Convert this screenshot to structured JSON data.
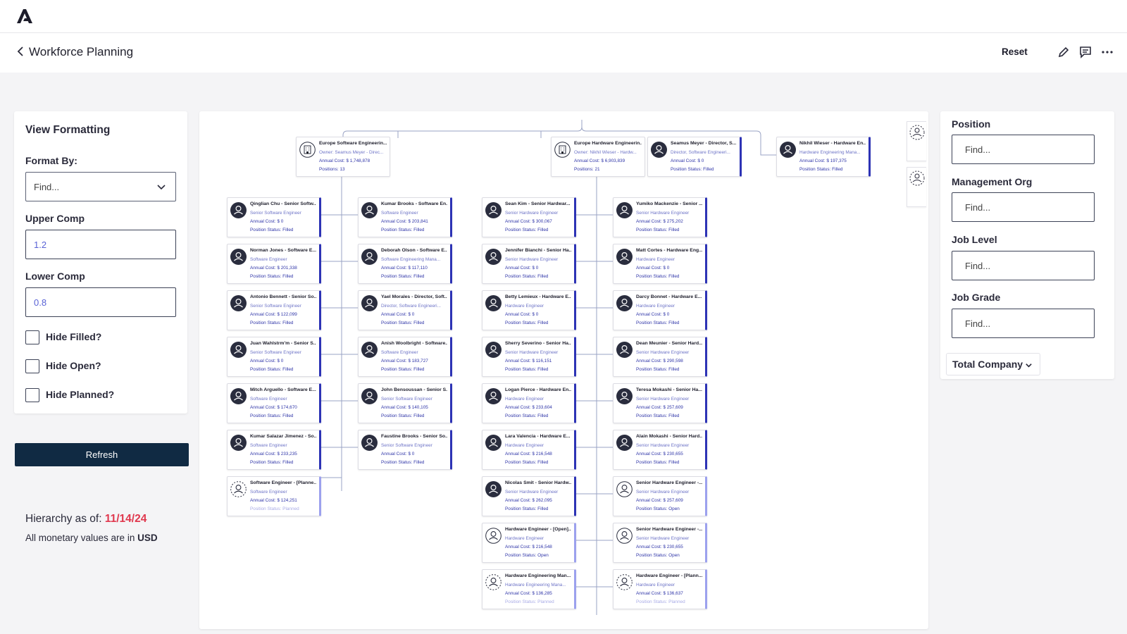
{
  "header": {
    "logo": "brand-logo",
    "title": "Workforce Planning",
    "reset_label": "Reset",
    "icons": [
      "pencil-icon",
      "comment-icon",
      "more-icon"
    ]
  },
  "view_formatting": {
    "title": "View Formatting",
    "format_by_label": "Format By:",
    "format_by_value": "Find...",
    "upper_comp_label": "Upper Comp",
    "upper_comp_value": "1.2",
    "lower_comp_label": "Lower Comp",
    "lower_comp_value": "0.8",
    "checkboxes": [
      {
        "label": "Hide Filled?",
        "checked": false
      },
      {
        "label": "Hide Open?",
        "checked": false
      },
      {
        "label": "Hide Planned?",
        "checked": false
      }
    ],
    "refresh_label": "Refresh"
  },
  "footer_info": {
    "hierarchy_label": "Hierarchy as of:",
    "hierarchy_date": "11/14/24",
    "money_label": "All monetary values are in",
    "currency": "USD"
  },
  "filters": {
    "position_label": "Position",
    "position_placeholder": "Find...",
    "management_org_label": "Management Org",
    "management_org_placeholder": "Find...",
    "job_level_label": "Job Level",
    "job_level_placeholder": "Find...",
    "job_grade_label": "Job Grade",
    "job_grade_placeholder": "Find...",
    "scope_label": "Total Company"
  },
  "org_chart": {
    "colors": {
      "accent": "#2d33b5",
      "accent_light": "#9ca1ee",
      "text_blue": "#2f35a8",
      "line": "#9aa3c4"
    },
    "top_nodes": [
      {
        "type": "org",
        "title": "Europe Software Engineerin...",
        "line2": "Owner: Seamus Meyer - Direc...",
        "line3": "Annual Cost: $ 1,748,878",
        "line4": "Positions: 13"
      },
      {
        "type": "org",
        "title": "Europe Hardware Engineerin...",
        "line2": "Owner: Nikhil Wieser - Hardw...",
        "line3": "Annual Cost: $ 6,903,839",
        "line4": "Positions: 21"
      },
      {
        "type": "person",
        "title": "Seamus Meyer - Director, S...",
        "line2": "Director, Software Engineeri...",
        "line3": "Annual Cost: $ 0",
        "line4": "Position Status: Filled"
      },
      {
        "type": "person",
        "title": "Nikhil Wieser - Hardware En...",
        "line2": "Hardware Engineering Mana...",
        "line3": "Annual Cost: $ 197,375",
        "line4": "Position Status: Filled"
      }
    ],
    "sw_col1": [
      {
        "status": "filled",
        "title": "Qinglian Chu - Senior Softw...",
        "role": "Senior Software Engineer",
        "cost": "Annual Cost: $ 0",
        "pstatus": "Position Status: Filled"
      },
      {
        "status": "filled",
        "title": "Norman Jones - Software E...",
        "role": "Software Engineer",
        "cost": "Annual Cost: $ 201,338",
        "pstatus": "Position Status: Filled"
      },
      {
        "status": "filled",
        "title": "Antonio Bennett - Senior So...",
        "role": "Senior Software Engineer",
        "cost": "Annual Cost: $ 122,099",
        "pstatus": "Position Status: Filled"
      },
      {
        "status": "filled",
        "title": "Juan Wahlstrm'm - Senior S...",
        "role": "Senior Software Engineer",
        "cost": "Annual Cost: $ 0",
        "pstatus": "Position Status: Filled"
      },
      {
        "status": "filled",
        "title": "Mitch Arguello - Software E...",
        "role": "Software Engineer",
        "cost": "Annual Cost: $ 174,670",
        "pstatus": "Position Status: Filled"
      },
      {
        "status": "filled",
        "title": "Kumar Salazar Jimenez - So...",
        "role": "Software Engineer",
        "cost": "Annual Cost: $ 233,235",
        "pstatus": "Position Status: Filled"
      },
      {
        "status": "planned",
        "title": "Software Engineer - [Planne...",
        "role": "Software Engineer",
        "cost": "Annual Cost: $ 124,251",
        "pstatus": "Position Status: Planned"
      }
    ],
    "sw_col2": [
      {
        "status": "filled",
        "title": "Kumar Brooks - Software En...",
        "role": "Software Engineer",
        "cost": "Annual Cost: $ 203,841",
        "pstatus": "Position Status: Filled"
      },
      {
        "status": "filled",
        "title": "Deborah Olson - Software E...",
        "role": "Software Engineering Mana...",
        "cost": "Annual Cost: $ 117,110",
        "pstatus": "Position Status: Filled"
      },
      {
        "status": "filled",
        "title": "Yael Morales - Director, Soft...",
        "role": "Director, Software Engineeri...",
        "cost": "Annual Cost: $ 0",
        "pstatus": "Position Status: Filled"
      },
      {
        "status": "filled",
        "title": "Anish Woolbright - Software...",
        "role": "Software Engineer",
        "cost": "Annual Cost: $ 183,727",
        "pstatus": "Position Status: Filled"
      },
      {
        "status": "filled",
        "title": "John Bensoussan - Senior S...",
        "role": "Senior Software Engineer",
        "cost": "Annual Cost: $ 140,105",
        "pstatus": "Position Status: Filled"
      },
      {
        "status": "filled",
        "title": "Faustine Brooks - Senior So...",
        "role": "Senior Software Engineer",
        "cost": "Annual Cost: $ 0",
        "pstatus": "Position Status: Filled"
      }
    ],
    "hw_col1": [
      {
        "status": "filled",
        "title": "Sean Kim - Senior Hardwar...",
        "role": "Senior Hardware Engineer",
        "cost": "Annual Cost: $ 300,067",
        "pstatus": "Position Status: Filled"
      },
      {
        "status": "filled",
        "title": "Jennifer Bianchi - Senior Ha...",
        "role": "Senior Hardware Engineer",
        "cost": "Annual Cost: $ 0",
        "pstatus": "Position Status: Filled"
      },
      {
        "status": "filled",
        "title": "Betty Lemieux - Hardware E...",
        "role": "Hardware Engineer",
        "cost": "Annual Cost: $ 0",
        "pstatus": "Position Status: Filled"
      },
      {
        "status": "filled",
        "title": "Sherry Severino - Senior Ha...",
        "role": "Senior Hardware Engineer",
        "cost": "Annual Cost: $ 116,151",
        "pstatus": "Position Status: Filled"
      },
      {
        "status": "filled",
        "title": "Logan Pierce - Hardware En...",
        "role": "Hardware Engineer",
        "cost": "Annual Cost: $ 233,604",
        "pstatus": "Position Status: Filled"
      },
      {
        "status": "filled",
        "title": "Lara Valencia - Hardware E...",
        "role": "Hardware Engineer",
        "cost": "Annual Cost: $ 216,548",
        "pstatus": "Position Status: Filled"
      },
      {
        "status": "filled",
        "title": "Nicolas Smit - Senior Hardw...",
        "role": "Senior Hardware Engineer",
        "cost": "Annual Cost: $ 262,095",
        "pstatus": "Position Status: Filled"
      },
      {
        "status": "open",
        "title": "Hardware Engineer - [Open]...",
        "role": "Hardware Engineer",
        "cost": "Annual Cost: $ 216,548",
        "pstatus": "Position Status: Open"
      },
      {
        "status": "planned",
        "title": "Hardware Engineering Man...",
        "role": "Hardware Engineering Mana...",
        "cost": "Annual Cost: $ 136,285",
        "pstatus": "Position Status: Planned"
      }
    ],
    "hw_col2": [
      {
        "status": "filled",
        "title": "Yumiko Mackenzie - Senior ...",
        "role": "Senior Hardware Engineer",
        "cost": "Annual Cost: $ 275,202",
        "pstatus": "Position Status: Filled"
      },
      {
        "status": "filled",
        "title": "Matt Cortes - Hardware Eng...",
        "role": "Hardware Engineer",
        "cost": "Annual Cost: $ 0",
        "pstatus": "Position Status: Filled"
      },
      {
        "status": "filled",
        "title": "Darcy Bonnet - Hardware E...",
        "role": "Hardware Engineer",
        "cost": "Annual Cost: $ 0",
        "pstatus": "Position Status: Filled"
      },
      {
        "status": "filled",
        "title": "Dean Meunier - Senior Hard...",
        "role": "Senior Hardware Engineer",
        "cost": "Annual Cost: $ 290,598",
        "pstatus": "Position Status: Filled"
      },
      {
        "status": "filled",
        "title": "Teresa Mokashi - Senior Ha...",
        "role": "Senior Hardware Engineer",
        "cost": "Annual Cost: $ 257,609",
        "pstatus": "Position Status: Filled"
      },
      {
        "status": "filled",
        "title": "Alain Mokashi - Senior Hard...",
        "role": "Senior Hardware Engineer",
        "cost": "Annual Cost: $ 230,655",
        "pstatus": "Position Status: Filled"
      },
      {
        "status": "open",
        "title": "Senior Hardware Engineer -...",
        "role": "Senior Hardware Engineer",
        "cost": "Annual Cost: $ 257,609",
        "pstatus": "Position Status: Open"
      },
      {
        "status": "open",
        "title": "Senior Hardware Engineer -...",
        "role": "Senior Hardware Engineer",
        "cost": "Annual Cost: $ 230,655",
        "pstatus": "Position Status: Open"
      },
      {
        "status": "planned",
        "title": "Hardware Engineer - [Plann...",
        "role": "Hardware Engineer",
        "cost": "Annual Cost: $ 136,637",
        "pstatus": "Position Status: Planned"
      }
    ]
  }
}
